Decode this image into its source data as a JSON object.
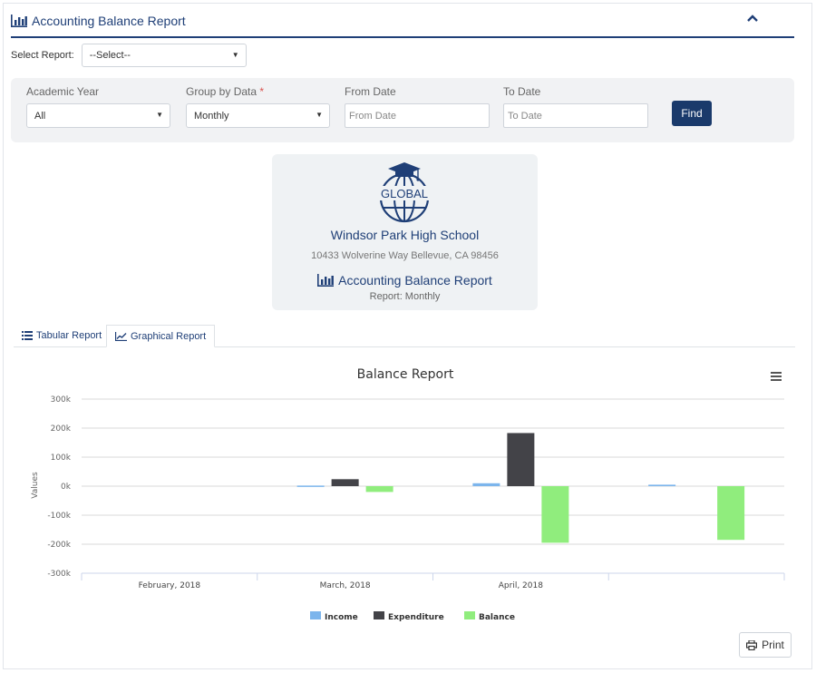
{
  "header": {
    "title": "Accounting Balance Report"
  },
  "report_select": {
    "label": "Select Report:",
    "value": "--Select--"
  },
  "filters": {
    "academic_year": {
      "label": "Academic Year",
      "value": "All"
    },
    "group_by": {
      "label": "Group by Data",
      "required_mark": "*",
      "value": "Monthly"
    },
    "from_date": {
      "label": "From Date",
      "placeholder": "From Date"
    },
    "to_date": {
      "label": "To Date",
      "placeholder": "To Date"
    },
    "find_label": "Find"
  },
  "school": {
    "logo_text": "GLOBAL",
    "name": "Windsor Park High School",
    "address": "10433 Wolverine Way Bellevue, CA 98456",
    "report_title": "Accounting Balance Report",
    "report_sub": "Report: Monthly"
  },
  "tabs": [
    {
      "label": "Tabular Report"
    },
    {
      "label": "Graphical Report"
    }
  ],
  "print_label": "Print",
  "chart_data": {
    "type": "bar",
    "title": "Balance Report",
    "xlabel": "",
    "ylabel": "Values",
    "ylim": [
      -300000,
      300000
    ],
    "yticks": [
      "300k",
      "200k",
      "100k",
      "0k",
      "-100k",
      "-200k",
      "-300k"
    ],
    "categories": [
      "February, 2018",
      "March, 2018",
      "April, 2018",
      ""
    ],
    "series": [
      {
        "name": "Income",
        "color": "#7cb5ec",
        "values": [
          0,
          2000,
          10000,
          5000
        ]
      },
      {
        "name": "Expenditure",
        "color": "#434348",
        "values": [
          0,
          24000,
          183000,
          0
        ]
      },
      {
        "name": "Balance",
        "color": "#90ed7d",
        "values": [
          0,
          -20000,
          -195000,
          -185000
        ]
      }
    ],
    "grid": true,
    "legend": "bottom-center"
  }
}
